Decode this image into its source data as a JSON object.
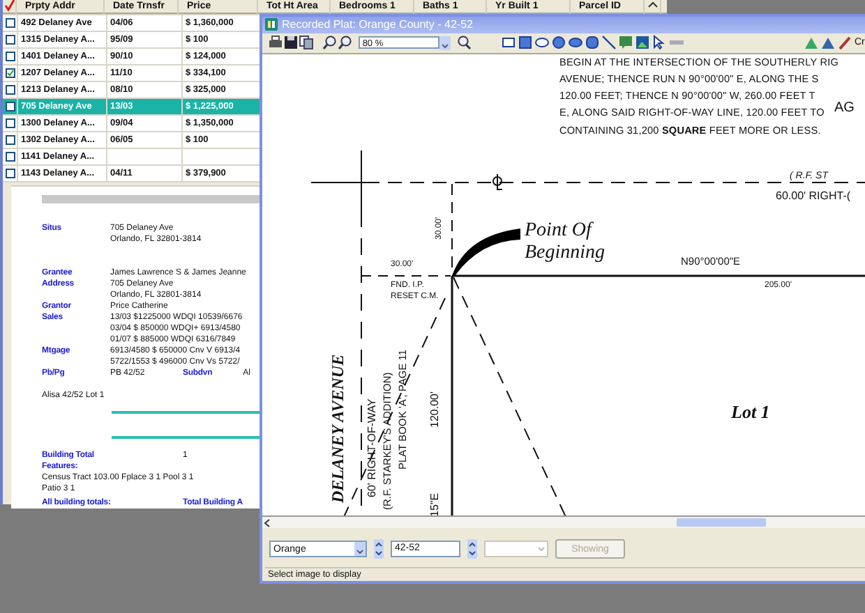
{
  "property_table": {
    "columns": [
      "Prpty Addr",
      "Date Trnsfr",
      "Price",
      "Tot Ht Area",
      "Bedrooms 1",
      "Baths 1",
      "Yr Built 1",
      "Parcel ID"
    ],
    "rows": [
      {
        "address": "492 Delaney Ave",
        "date": "04/06",
        "price": "$ 1,360,000",
        "checked": false,
        "selected": false
      },
      {
        "address": "1315 Delaney A...",
        "date": "95/09",
        "price": "$ 100",
        "checked": false,
        "selected": false
      },
      {
        "address": "1401 Delaney A...",
        "date": "90/10",
        "price": "$ 124,000",
        "checked": false,
        "selected": false
      },
      {
        "address": "1207 Delaney A...",
        "date": "11/10",
        "price": "$ 334,100",
        "checked": true,
        "selected": false
      },
      {
        "address": "1213 Delaney A...",
        "date": "08/10",
        "price": "$ 325,000",
        "checked": false,
        "selected": false
      },
      {
        "address": "705 Delaney Ave",
        "date": "13/03",
        "price": "$ 1,225,000",
        "checked": false,
        "selected": true
      },
      {
        "address": "1300 Delaney A...",
        "date": "09/04",
        "price": "$ 1,350,000",
        "checked": false,
        "selected": false
      },
      {
        "address": "1302 Delaney A...",
        "date": "06/05",
        "price": "$ 100",
        "checked": false,
        "selected": false
      },
      {
        "address": "1141 Delaney A...",
        "date": "",
        "price": "",
        "checked": false,
        "selected": false
      },
      {
        "address": "1143 Delaney A...",
        "date": "04/11",
        "price": "$ 379,900",
        "checked": false,
        "selected": false
      }
    ]
  },
  "details": {
    "sections": [
      {
        "rows": [
          {
            "label": "Situs",
            "value": "705 Delaney Ave"
          },
          {
            "value": "Orlando, FL 32801-3814"
          }
        ]
      },
      {
        "rows": [
          {
            "label": "Grantee",
            "value": "James Lawrence S & James Jeanne"
          },
          {
            "label": "Address",
            "value": "705 Delaney Ave"
          },
          {
            "value": "Orlando, FL 32801-3814"
          }
        ]
      },
      {
        "rows": [
          {
            "label": "Grantor",
            "value": "Price Catherine"
          },
          {
            "label": "Sales",
            "value": "13/03 $1225000 WDQI 10539/6676"
          },
          {
            "value": "03/04 $ 850000 WDQI+ 6913/4580"
          },
          {
            "value": "01/07 $ 885000 WDQI 6316/7849"
          },
          {
            "label": "Mtgage",
            "value": "6913/4580 $ 650000 Cnv V 6913/4"
          },
          {
            "value": "5722/1553 $ 496000 Cnv Vs 5722/"
          },
          {
            "label": "Pb/Pg",
            "value": "PB 42/52",
            "label_2": "Subdvn",
            "value_2": "Al"
          }
        ]
      }
    ],
    "legal_note": "Alisa 42/52 Lot 1",
    "building": {
      "total_label": "Building Total",
      "total_value": "1",
      "features_label": "Features:",
      "features_lines": [
        "Census Tract 103.00 Fplace 3 1 Pool 3 1",
        "Patio 3 1"
      ],
      "totals_label": "All building totals:",
      "totals_label_2": "Total Building A"
    }
  },
  "plat_window": {
    "title": "Recorded Plat: Orange County - 42-52",
    "zoom": "80 %",
    "toolbar_button": "Cr",
    "drawing": {
      "legal_description": [
        "BEGIN AT THE INTERSECTION OF THE SOUTHERLY RIG",
        "AVENUE;   THENCE RUN N 90°00'00\" E, ALONG THE S",
        "120.00 FEET; THENCE N 90°00'00\" W, 260.00 FEET T",
        "E, ALONG SAID RIGHT-OF-WAY LINE, 120.00 FEET TO"
      ],
      "area_note": "CONTAINING 31,200 **SQUARE** FEET MORE OR LESS.",
      "agency": "AG",
      "street_top": "( R.F. ST",
      "right_of_way_top": "60.00' RIGHT-(",
      "offset_vertical": "30.00'",
      "point_of_beginning": [
        "Point Of",
        "Beginning"
      ],
      "bearing_top": "N90°00'00\"E",
      "offset_horizontal": "30.00'",
      "monument": [
        "FND. I.P.",
        "RESET C.M."
      ],
      "distance_top": "205.00'",
      "street_name": "DELANEY AVENUE",
      "right_of_way": "60' RIGHT-OF-WAY",
      "addition": "(R.F. STARKEY'S  ADDITION)",
      "plat_book": "PLAT BOOK 'A', PAGE 11",
      "distance_side": "120.00'",
      "bearing_side": "15\"E",
      "lot": "Lot 1"
    },
    "county": "Orange",
    "plat_number": "42-52",
    "show_button": {
      "label": "Showing",
      "disabled": true
    },
    "status": "Select image to display"
  }
}
